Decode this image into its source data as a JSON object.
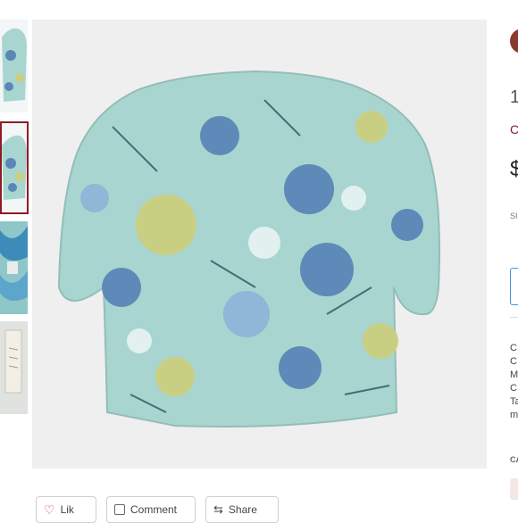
{
  "thumbnails": [
    {
      "name": "thumb-1-front"
    },
    {
      "name": "thumb-2-back",
      "selected": true
    },
    {
      "name": "thumb-3-detail"
    },
    {
      "name": "thumb-4-tag"
    }
  ],
  "right_panel": {
    "title_fragment": "1",
    "brand_fragment": "C",
    "price_fragment": "$",
    "size_fragment": "SI",
    "desc_lines": [
      "C",
      "C",
      "M",
      "C",
      "Ta",
      "m"
    ],
    "category_fragment": "CA"
  },
  "actions": {
    "like_label": "Lik",
    "comment_label": "Comment",
    "share_label": "Share"
  },
  "colors": {
    "accent": "#8e1c25",
    "blouse_base": "#a9d5d0",
    "flower_blue": "#5b86b8",
    "flower_yellow": "#cbcf7e"
  }
}
